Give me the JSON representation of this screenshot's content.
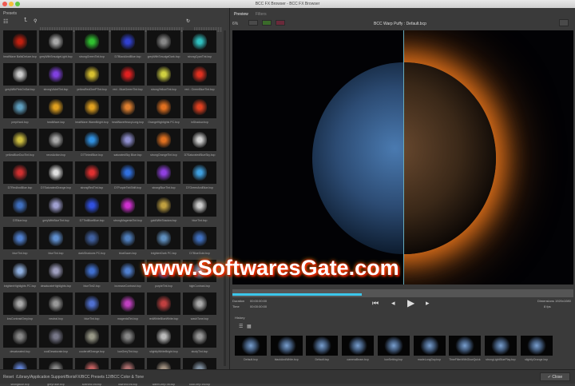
{
  "window": {
    "title": "BCC FX Browser - BCC FX Browser"
  },
  "left": {
    "title": "Presets",
    "presets": [
      "heatWave BalisDeluxe.bcp",
      "greyWithSmudgeLight.bcp",
      "strongGreenTint.bcp",
      "D7BlackAndBlue.bcp",
      "greyWithSmudgeDark.bcp",
      "strongCyanTint.bcp",
      "greyWithPinkOnSat.bcp",
      "strongVioletTint.bcp",
      "yellowRedOnePTint.bcp",
      "red - BlueGreenTint.bcp",
      "strongYellowTint.bcp",
      "red - GreenBlueTint.bcp",
      "prepHard.bcp",
      "heatWave.bcp",
      "heatWave WarmBright.bcp",
      "heatWaveHeavyLong.bcp",
      "OrangeHighlights PC.bcp",
      "inShadow.bcp",
      "yellowBlueDuoTint.bcp",
      "neonAction.bcp",
      "D7TintedBlue.bcp",
      "saturatedSky Blue.bcp",
      "strongOrangeTint.bcp",
      "D7SaturatedBlueSky.bcp",
      "D7RedAndBlue.bcp",
      "D7SaturatedOrange.bcp",
      "strongRedTint.bcp",
      "D7PurpleTintShift.bcp",
      "strongBlueTint.bcp",
      "D7GreenAndBlue.bcp",
      "D7Blue.bcp",
      "greyWithBlueTint.bcp",
      "D7TintBlueBlue.bcp",
      "strongMagentaTint.bcp",
      "goldWithShadow.bcp",
      "blueTint.bcp",
      "blueTint.bcp",
      "blueTint.bcp",
      "darkShadows PC.bcp",
      "blueDawn.bcp",
      "brightenDark PC.bcp",
      "D7BlueGold.bcp",
      "brightenHighlights PC.bcp",
      "desaturateHighlights.bcp",
      "blueTint2.bcp",
      "increaseContrast.bcp",
      "purpleTint.bcp",
      "highContrast.bcp",
      "lowContrastGrey.bcp",
      "neutral.bcp",
      "blueTint.bcp",
      "magentaTint.bcp",
      "redWhiteBlueWhite.bcp",
      "washTone.bcp",
      "desaturated.bcp",
      "coolDesaturate.bcp",
      "cooleroffOrange.bcp",
      "lowGreyTint.bcp",
      "slightlyWhiteBright.bcp",
      "studyTint.bcp",
      "strongBlue.bcp",
      "greyFade.bcp",
      "softRedTint.bcp",
      "lowRedTint.bcp",
      "warmGreyTint.bcp",
      "coolGreyTint.bcp"
    ],
    "colors": [
      "#c02010",
      "#aaa",
      "#30c030",
      "#3040d0",
      "#888",
      "#30c0c0",
      "#ccc",
      "#8040e0",
      "#d8c030",
      "#e02020",
      "#d0d040",
      "#e03020",
      "#60a0c0",
      "#e0a020",
      "#e0a020",
      "#e08030",
      "#e07020",
      "#e04020",
      "#d0c040",
      "#aaa",
      "#3090e0",
      "#9090d0",
      "#e07020",
      "#d0d0d0",
      "#d03030",
      "#e0e0e0",
      "#e03030",
      "#3070e0",
      "#9040e0",
      "#40a0e0",
      "#4070c0",
      "#a0a0d0",
      "#3050e0",
      "#d030d0",
      "#c0a040",
      "#ccc",
      "#5080d0",
      "#6090d0",
      "#4060a0",
      "#5080c0",
      "#6090c0",
      "#4070c0",
      "#90b0e0",
      "#a0a0c0",
      "#4070d0",
      "#5080d0",
      "#8050d0",
      "#7090d0",
      "#aaa",
      "#999",
      "#5070d0",
      "#c040c0",
      "#c04040",
      "#aaa",
      "#888",
      "#778",
      "#998",
      "#888",
      "#bbb",
      "#999",
      "#6080d0",
      "#888",
      "#c06060",
      "#b07070",
      "#a09080",
      "#8090a0"
    ]
  },
  "right": {
    "tabs": [
      "Preview",
      "Filters"
    ],
    "zoom": "6%",
    "preset_title": "BCC Warp Puffy : Default.bcp",
    "duration_label": "Duration",
    "duration": "00:00:00:00",
    "time_label": "Time",
    "time": "00:00:00:00",
    "dimensions": "Dimensions 1920x1080",
    "fps": "8 fps",
    "timeline_progress": 0.38,
    "history_title": "History",
    "history": [
      "Default.bcp",
      "blackAndWhite.bcp",
      "Default.bcp",
      "cameraBeam.bcp",
      "lowSetting.bcp",
      "madeLongDay.bcp",
      "TimeFilterWithGlowQuick.bcp",
      "strongLightBluePlay.bcp",
      "slightlyOrange.bcp"
    ]
  },
  "watermark": "www.SoftwaresGate.com",
  "status": {
    "reset": "Reset",
    "path": "/Library/Application Support/BorisFX/BCC Presets 12/BCC Color & Tone",
    "close": "Close"
  }
}
